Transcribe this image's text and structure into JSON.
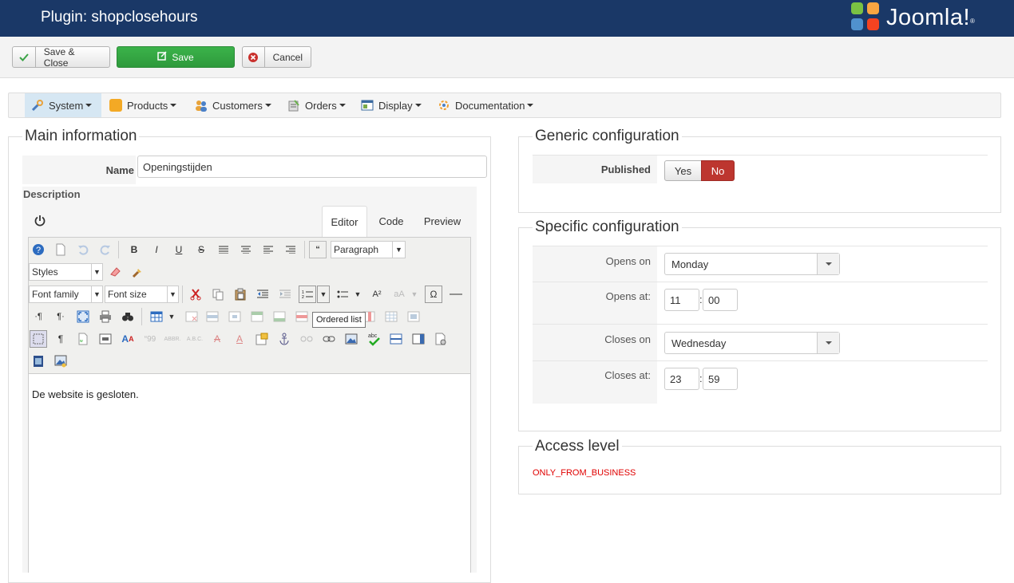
{
  "header": {
    "title": "Plugin: shopclosehours",
    "brand": "Joomla!"
  },
  "toolbar": {
    "save_close": "Save & Close",
    "save": "Save",
    "cancel": "Cancel"
  },
  "menu": {
    "items": [
      {
        "label": "System",
        "icon": "wrench-icon"
      },
      {
        "label": "Products",
        "icon": "products-icon"
      },
      {
        "label": "Customers",
        "icon": "customers-icon"
      },
      {
        "label": "Orders",
        "icon": "orders-icon"
      },
      {
        "label": "Display",
        "icon": "display-icon"
      },
      {
        "label": "Documentation",
        "icon": "documentation-icon"
      }
    ]
  },
  "main": {
    "legend": "Main information",
    "name_label": "Name",
    "name_value": "Openingstijden",
    "description_label": "Description",
    "tabs": {
      "editor": "Editor",
      "code": "Code",
      "preview": "Preview"
    },
    "paragraph_select": "Paragraph",
    "styles_select": "Styles",
    "font_family_select": "Font family",
    "font_size_select": "Font size",
    "tooltip": "Ordered list",
    "content": "De website is gesloten."
  },
  "generic": {
    "legend": "Generic configuration",
    "published_label": "Published",
    "yes": "Yes",
    "no": "No"
  },
  "specific": {
    "legend": "Specific configuration",
    "opens_on_label": "Opens on",
    "opens_on_value": "Monday",
    "opens_at_label": "Opens at:",
    "opens_hour": "11",
    "opens_minute": "00",
    "closes_on_label": "Closes on",
    "closes_on_value": "Wednesday",
    "closes_at_label": "Closes at:",
    "closes_hour": "23",
    "closes_minute": "59",
    "time_separator": ":"
  },
  "access": {
    "legend": "Access level",
    "value": "ONLY_FROM_BUSINESS"
  },
  "colors": {
    "header": "#1a3867",
    "save": "#3bb34a",
    "no_active": "#bd362f",
    "access_value": "#e00000"
  }
}
